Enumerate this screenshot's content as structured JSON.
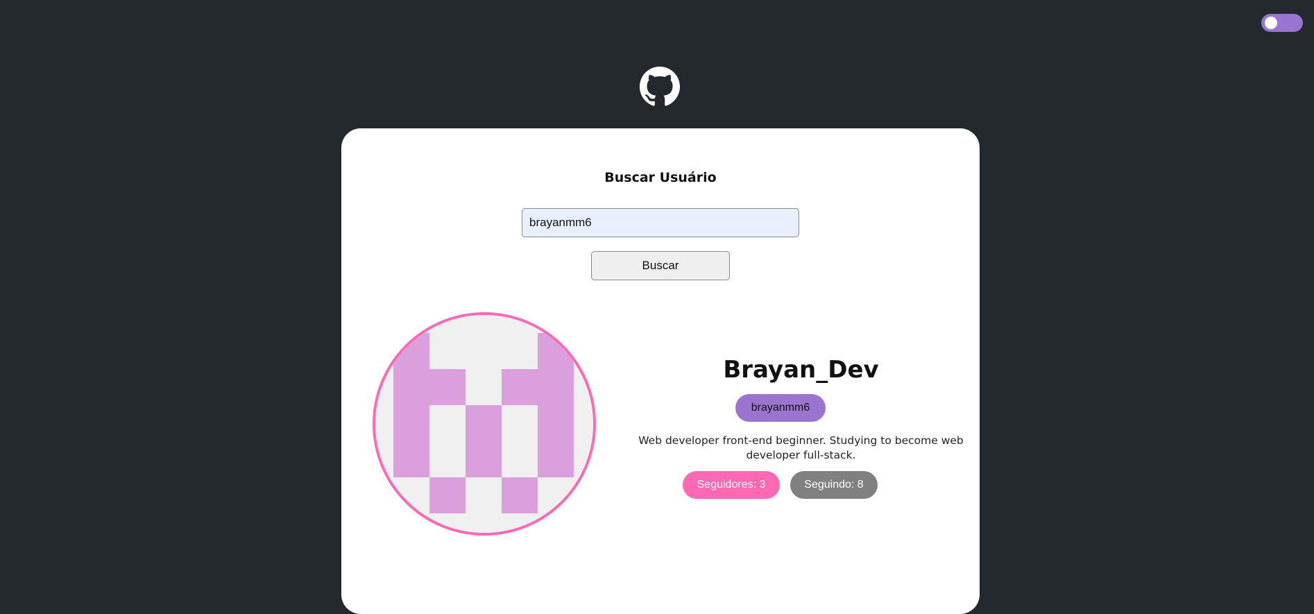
{
  "theme_toggle": {
    "icon": "toggle-switch",
    "accent": "#9a74cf"
  },
  "header": {
    "logo_icon": "github-icon"
  },
  "search": {
    "title": "Buscar Usuário",
    "input_value": "brayanmm6",
    "button_label": "Buscar"
  },
  "profile": {
    "name": "Brayan_Dev",
    "login": "brayanmm6",
    "bio": "Web developer front-end beginner. Studying to become web developer full-stack.",
    "followers_label": "Seguidores: 3",
    "following_label": "Seguindo: 8",
    "avatar_border": "#ff69b4",
    "avatar_color": "#dc9fdd"
  }
}
